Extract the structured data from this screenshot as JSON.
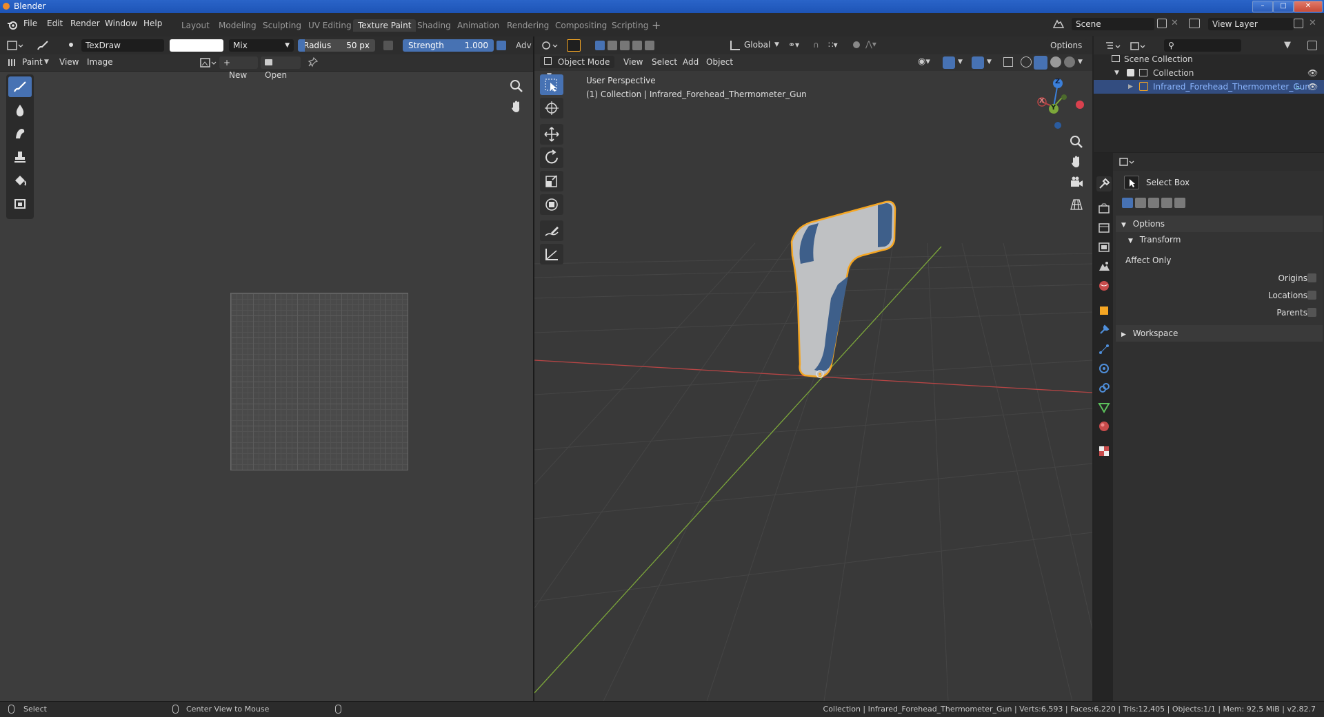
{
  "window": {
    "title": "Blender"
  },
  "menus": [
    "File",
    "Edit",
    "Render",
    "Window",
    "Help"
  ],
  "workspaces": [
    {
      "label": "Layout",
      "active": false
    },
    {
      "label": "Modeling",
      "active": false
    },
    {
      "label": "Sculpting",
      "active": false
    },
    {
      "label": "UV Editing",
      "active": false
    },
    {
      "label": "Texture Paint",
      "active": true
    },
    {
      "label": "Shading",
      "active": false
    },
    {
      "label": "Animation",
      "active": false
    },
    {
      "label": "Rendering",
      "active": false
    },
    {
      "label": "Compositing",
      "active": false
    },
    {
      "label": "Scripting",
      "active": false
    }
  ],
  "scene": {
    "name": "Scene",
    "view_layer": "View Layer"
  },
  "image_editor": {
    "brush_name": "TexDraw",
    "blend_mode": "Mix",
    "radius_label": "Radius",
    "radius_value": "50 px",
    "strength_label": "Strength",
    "strength_value": "1.000",
    "adv_label": "Adv",
    "mode": "Paint",
    "menu_view": "View",
    "menu_image": "Image",
    "new_label": "New",
    "open_label": "Open"
  },
  "viewport": {
    "mode": "Object Mode",
    "menu": [
      "View",
      "Select",
      "Add",
      "Object"
    ],
    "transform_orientation": "Global",
    "options_label": "Options",
    "perspective_text": "User Perspective",
    "collection_text": "(1) Collection | Infrared_Forehead_Thermometer_Gun",
    "gizmo_axes": {
      "z": "Z",
      "y": "Y",
      "x": "X"
    }
  },
  "outliner": {
    "scene_collection": "Scene Collection",
    "collection": "Collection",
    "object": "Infrared_Forehead_Thermometer_Gun"
  },
  "properties": {
    "tool_name": "Select Box",
    "options_label": "Options",
    "transform_label": "Transform",
    "affect_only_label": "Affect Only",
    "origins_label": "Origins",
    "locations_label": "Locations",
    "parents_label": "Parents",
    "workspace_label": "Workspace"
  },
  "statusbar": {
    "select": "Select",
    "center_view": "Center View to Mouse",
    "stats": "Collection | Infrared_Forehead_Thermometer_Gun | Verts:6,593 | Faces:6,220 | Tris:12,405 | Objects:1/1 | Mem: 92.5 MiB | v2.82.7"
  },
  "colors": {
    "accent": "#4772b3",
    "selection_outline": "#f5a623",
    "x_axis": "#b84545",
    "y_axis": "#7da83a",
    "z_axis": "#3b7fd9"
  }
}
